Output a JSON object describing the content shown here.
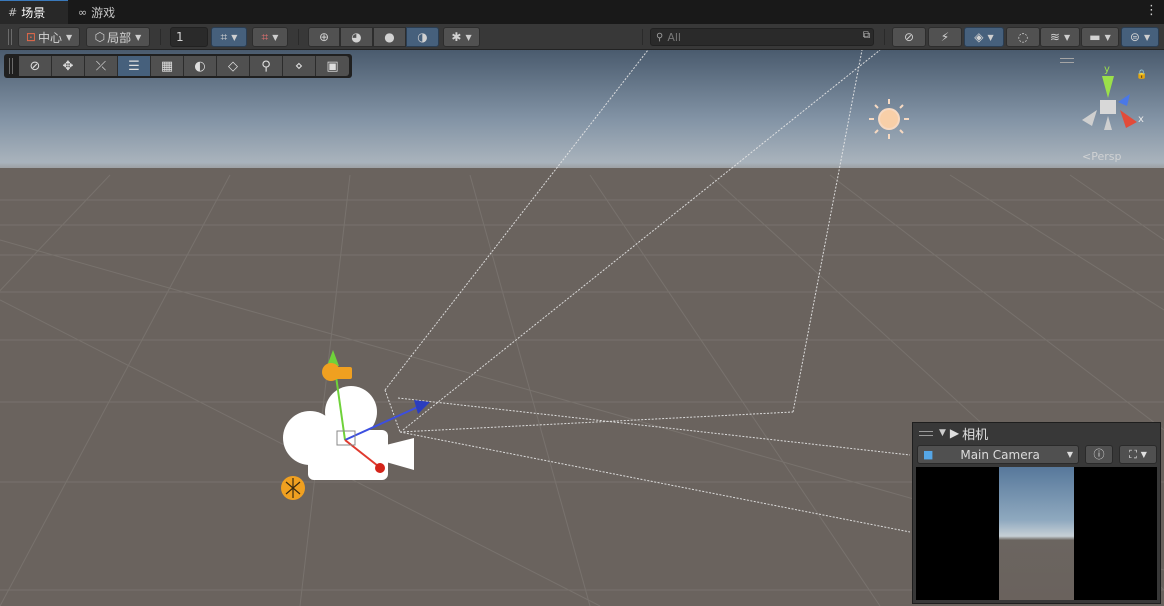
{
  "tabs": [
    {
      "label": "场景",
      "icon": "grid-icon",
      "active": true
    },
    {
      "label": "游戏",
      "icon": "gamepad-icon",
      "active": false
    }
  ],
  "toolbar": {
    "pivot_label": "中心",
    "space_label": "局部",
    "grid_size": "1",
    "search_placeholder": "All"
  },
  "tools": [
    {
      "name": "view-tool",
      "icon": "compass-icon"
    },
    {
      "name": "move-tool",
      "icon": "move-arrows-icon"
    },
    {
      "name": "rotate-tool",
      "icon": "rotate-icon"
    },
    {
      "name": "scale-tool",
      "icon": "sliders-icon"
    },
    {
      "name": "rect-tool",
      "icon": "rect-icon"
    },
    {
      "name": "transform-tool",
      "icon": "halfcircle-icon"
    },
    {
      "name": "custom-tool",
      "icon": "layers-icon"
    },
    {
      "name": "zoom-tool",
      "icon": "search-icon"
    },
    {
      "name": "pivot-tool",
      "icon": "node-icon"
    },
    {
      "name": "camera-tool",
      "icon": "camera-icon"
    }
  ],
  "gizmo": {
    "y_label": "y",
    "x_label": "x",
    "projection_label": "Persp"
  },
  "camera_panel": {
    "title": "相机",
    "camera_name": "Main Camera"
  },
  "colors": {
    "accent": "#46607c",
    "toolbar_bg": "#383838",
    "ground": "#6b6560",
    "sky": "#8fa9bf"
  }
}
